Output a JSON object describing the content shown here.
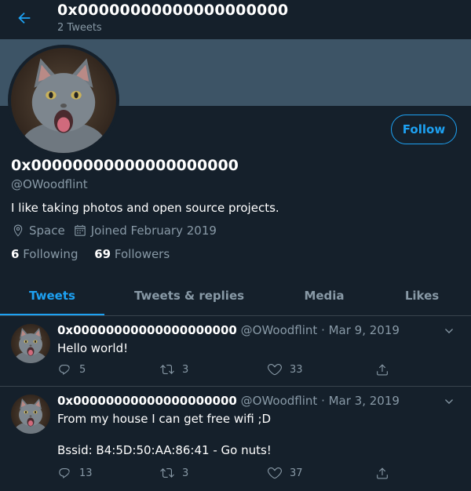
{
  "header": {
    "title": "0x00000000000000000000",
    "subtitle": "2 Tweets"
  },
  "profile": {
    "display_name": "0x00000000000000000000",
    "handle": "@OWoodflint",
    "bio": "I like taking photos and open source projects.",
    "location": "Space",
    "joined": "Joined February 2019",
    "following_count": "6",
    "following_label": "Following",
    "followers_count": "69",
    "followers_label": "Followers",
    "follow_label": "Follow"
  },
  "tabs": [
    {
      "label": "Tweets",
      "active": true
    },
    {
      "label": "Tweets & replies",
      "active": false
    },
    {
      "label": "Media",
      "active": false
    },
    {
      "label": "Likes",
      "active": false
    }
  ],
  "tweets": [
    {
      "name": "0x00000000000000000000",
      "handle": "@OWoodflint",
      "date": "Mar 9, 2019",
      "text": "Hello world!",
      "text2": "",
      "replies": "5",
      "retweets": "3",
      "likes": "33"
    },
    {
      "name": "0x00000000000000000000",
      "handle": "@OWoodflint",
      "date": "Mar 3, 2019",
      "text": "From my house I can get free wifi ;D",
      "text2": "Bssid: B4:5D:50:AA:86:41 - Go nuts!",
      "replies": "13",
      "retweets": "3",
      "likes": "37"
    }
  ],
  "colors": {
    "accent": "#1da1f2",
    "background": "#15202b",
    "banner": "#3d5466",
    "muted": "#8899a6"
  },
  "icons": [
    "back-arrow-icon",
    "location-icon",
    "calendar-icon",
    "chevron-down-icon",
    "reply-icon",
    "retweet-icon",
    "like-icon",
    "share-icon"
  ]
}
